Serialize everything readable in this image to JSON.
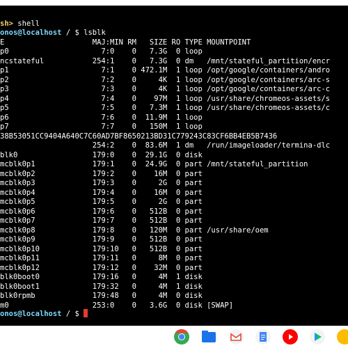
{
  "terminal": {
    "crosh_prompt": "sh>",
    "crosh_command": "shell",
    "prompt_user": "onos@localhost",
    "prompt_path": "/",
    "prompt_symbol": "$",
    "command": "lsblk",
    "header": "E                    MAJ:MIN RM   SIZE RO TYPE MOUNTPOINT",
    "rows": [
      "p0                     7:0    0   7.3G  0 loop",
      "ncstateful           254:1    0   7.3G  0 dm   /mnt/stateful_partition/encr",
      "p1                     7:1    0 472.1M  1 loop /opt/google/containers/andro",
      "p2                     7:2    0     4K  1 loop /opt/google/containers/arc-s",
      "p3                     7:3    0     4K  1 loop /opt/google/containers/arc-c",
      "p4                     7:4    0    97M  1 loop /usr/share/chromeos-assets/s",
      "p5                     7:5    0   7.3M  1 loop /usr/share/chromeos-assets/c",
      "p6                     7:6    0  11.9M  1 loop",
      "p7                     7:7    0   150M  1 loop",
      "38B53051CC9404A640C7C60AD7BF8650213BD31C779243C83CF6BB4EB5B7436",
      "                     254:2    0  83.6M  1 dm   /run/imageloader/termina-dlc",
      "blk0                 179:0    0  29.1G  0 disk",
      "mcblk0p1             179:1    0  24.9G  0 part /mnt/stateful_partition",
      "mcblk0p2             179:2    0    16M  0 part",
      "mcblk0p3             179:3    0     2G  0 part",
      "mcblk0p4             179:4    0    16M  0 part",
      "mcblk0p5             179:5    0     2G  0 part",
      "mcblk0p6             179:6    0   512B  0 part",
      "mcblk0p7             179:7    0   512B  0 part",
      "mcblk0p8             179:8    0   120M  0 part /usr/share/oem",
      "mcblk0p9             179:9    0   512B  0 part",
      "mcblk0p10            179:10   0   512B  0 part",
      "mcblk0p11            179:11   0     8M  0 part",
      "mcblk0p12            179:12   0    32M  0 part",
      "blk0boot0            179:16   0     4M  1 disk",
      "blk0boot1            179:32   0     4M  1 disk",
      "blk0rpmb             179:48   0     4M  0 disk",
      "m0                   253:0    0   3.6G  0 disk [SWAP]"
    ]
  },
  "taskbar": {
    "apps": [
      {
        "icon": "chrome-icon",
        "color": "#34a853"
      },
      {
        "icon": "files-icon",
        "color": "#1a73e8"
      },
      {
        "icon": "gmail-icon",
        "color": "#ea4335"
      },
      {
        "icon": "docs-icon",
        "color": "#4285f4"
      },
      {
        "icon": "youtube-icon",
        "color": "#ff0000"
      },
      {
        "icon": "play-store-icon",
        "color": "#00c853"
      },
      {
        "icon": "photos-icon",
        "color": "#fbbc04"
      }
    ]
  }
}
